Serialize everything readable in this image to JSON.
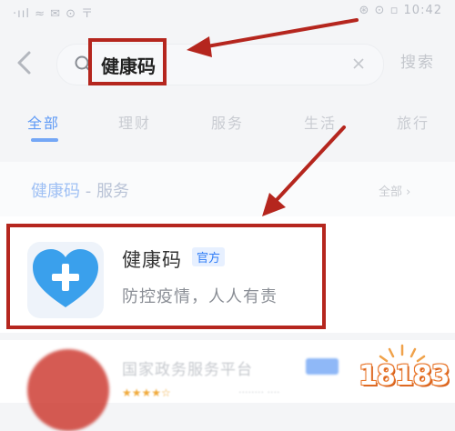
{
  "status_bar": {
    "left": "·ııl ≈ ✉ ⊙ 〒",
    "right": "⊛ ⊙ ▫ 10:42"
  },
  "search": {
    "value": "健康码",
    "action_label": "搜索"
  },
  "tabs": [
    {
      "label": "全部",
      "active": true
    },
    {
      "label": "理财",
      "active": false
    },
    {
      "label": "服务",
      "active": false
    },
    {
      "label": "生活",
      "active": false
    },
    {
      "label": "旅行",
      "active": false
    }
  ],
  "section": {
    "title_highlight": "健康码",
    "title_rest": " - 服务",
    "more_label": "全部 ›"
  },
  "result": {
    "name": "健康码",
    "badge": "官方",
    "description": "防控疫情，人人有责"
  },
  "result2": {
    "name": "国家政务服务平台",
    "stars": "★★★★☆",
    "meta": "········ ····"
  },
  "watermark": {
    "text": "18183"
  },
  "colors": {
    "accent": "#2f7cf6",
    "annotation": "#b5261e",
    "icon_heart": "#3aa0ec"
  }
}
